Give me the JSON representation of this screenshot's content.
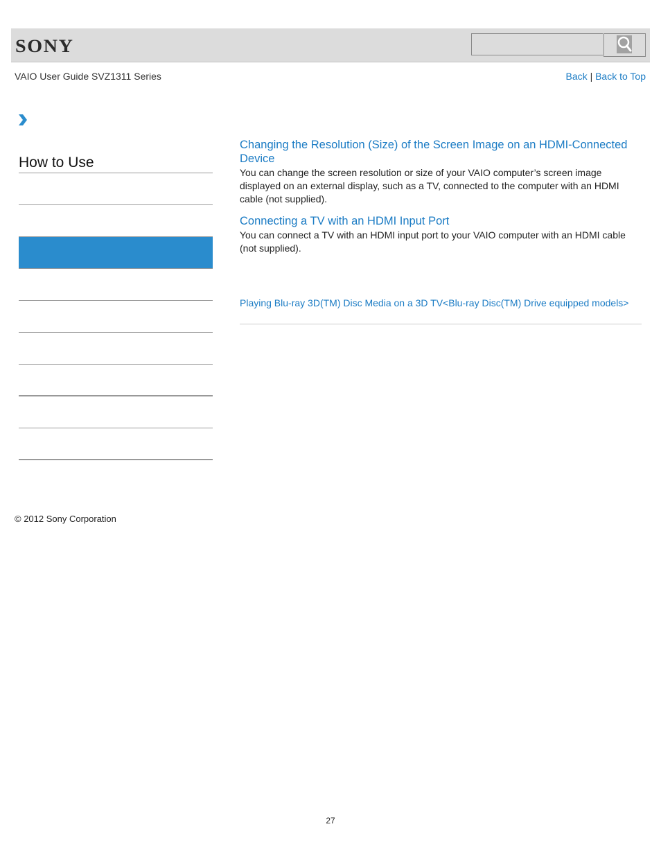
{
  "header": {
    "logo_text": "SONY",
    "search": {
      "placeholder": "",
      "value": "",
      "button_icon": "search-icon"
    }
  },
  "subheader": {
    "title": "VAIO User Guide SVZ1311 Series",
    "back_label": "Back",
    "separator": "|",
    "back_to_top_label": "Back to Top"
  },
  "breadcrumb": {
    "icon": "chevron-right-icon"
  },
  "sidebar": {
    "title": "How to Use",
    "items": [
      {
        "label": "",
        "active": false
      },
      {
        "label": "",
        "active": false
      },
      {
        "label": "",
        "active": true
      },
      {
        "label": "",
        "active": false
      },
      {
        "label": "",
        "active": false
      },
      {
        "label": "",
        "active": false
      },
      {
        "label": "",
        "active": false
      },
      {
        "label": "",
        "active": false
      },
      {
        "label": "",
        "active": false
      }
    ],
    "active_color": "#2a8ccd"
  },
  "main": {
    "topics": [
      {
        "title": "Changing the Resolution (Size) of the Screen Image on an HDMI-Connected Device",
        "description": "You can change the screen resolution or size of your VAIO computer’s screen image displayed on an external display, such as a TV, connected to the computer with an HDMI cable (not supplied)."
      },
      {
        "title": "Connecting a TV with an HDMI Input Port",
        "description": "You can connect a TV with an HDMI input port to your VAIO computer with an HDMI cable (not supplied)."
      }
    ],
    "related_link": "Playing Blu-ray 3D(TM) Disc Media on a 3D TV<Blu-ray Disc(TM) Drive equipped models>"
  },
  "footer": {
    "copyright": "© 2012 Sony Corporation",
    "page_number": "27"
  },
  "colors": {
    "link": "#1a7bc4",
    "header_bg": "#dcdcdc"
  }
}
